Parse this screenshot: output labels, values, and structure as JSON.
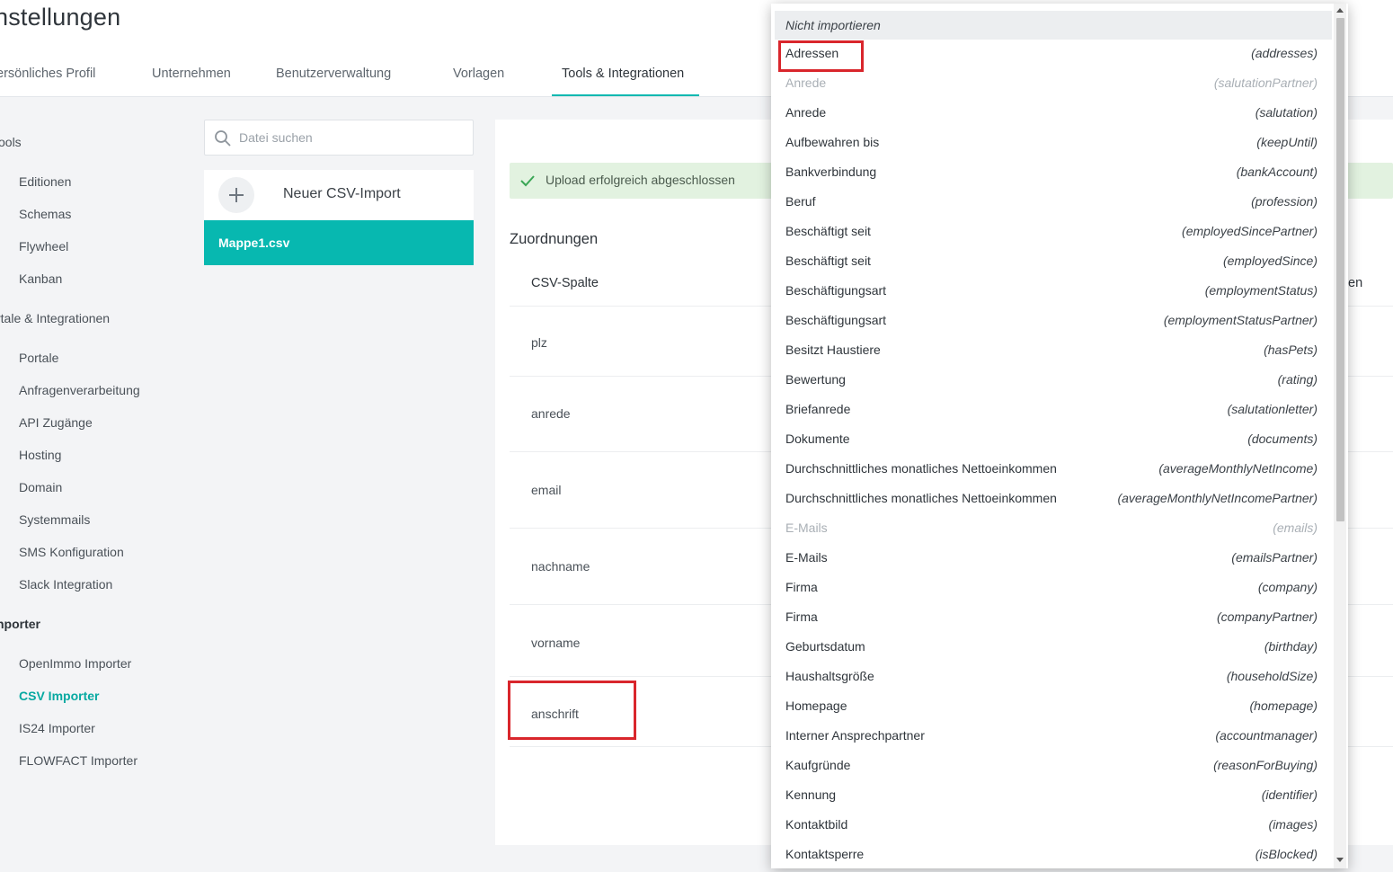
{
  "header": {
    "title": "nstellungen",
    "tabs": [
      {
        "label": "ersönliches Profil"
      },
      {
        "label": "Unternehmen"
      },
      {
        "label": "Benutzerverwaltung"
      },
      {
        "label": "Vorlagen"
      },
      {
        "label": "Tools & Integrationen"
      }
    ]
  },
  "sidebar": {
    "groups": [
      {
        "heading": "ools",
        "items": [
          "Editionen",
          "Schemas",
          "Flywheel",
          "Kanban"
        ]
      },
      {
        "heading": "rtale & Integrationen",
        "items": [
          "Portale",
          "Anfragenverarbeitung",
          "API Zugänge",
          "Hosting",
          "Domain",
          "Systemmails",
          "SMS Konfiguration",
          "Slack Integration"
        ]
      },
      {
        "heading": "nporter",
        "items": [
          "OpenImmo Importer",
          "CSV Importer",
          "IS24 Importer",
          "FLOWFACT Importer"
        ]
      }
    ]
  },
  "files": {
    "search_placeholder": "Datei suchen",
    "new_import_label": "Neuer CSV-Import",
    "selected_file": "Mappe1.csv"
  },
  "main": {
    "alert": "Upload erfolgreich abgeschlossen",
    "section_title": "Zuordnungen",
    "column_header": "CSV-Spalte",
    "column_header_peek": "en",
    "rows": [
      "plz",
      "anrede",
      "email",
      "nachname",
      "vorname",
      "anschrift"
    ]
  },
  "dropdown": {
    "header": "Nicht importieren",
    "items": [
      {
        "label": "Adressen",
        "key": "(addresses)",
        "disabled": false
      },
      {
        "label": "Anrede",
        "key": "(salutationPartner)",
        "disabled": true
      },
      {
        "label": "Anrede",
        "key": "(salutation)",
        "disabled": false
      },
      {
        "label": "Aufbewahren bis",
        "key": "(keepUntil)",
        "disabled": false
      },
      {
        "label": "Bankverbindung",
        "key": "(bankAccount)",
        "disabled": false
      },
      {
        "label": "Beruf",
        "key": "(profession)",
        "disabled": false
      },
      {
        "label": "Beschäftigt seit",
        "key": "(employedSincePartner)",
        "disabled": false
      },
      {
        "label": "Beschäftigt seit",
        "key": "(employedSince)",
        "disabled": false
      },
      {
        "label": "Beschäftigungsart",
        "key": "(employmentStatus)",
        "disabled": false
      },
      {
        "label": "Beschäftigungsart",
        "key": "(employmentStatusPartner)",
        "disabled": false
      },
      {
        "label": "Besitzt Haustiere",
        "key": "(hasPets)",
        "disabled": false
      },
      {
        "label": "Bewertung",
        "key": "(rating)",
        "disabled": false
      },
      {
        "label": "Briefanrede",
        "key": "(salutationletter)",
        "disabled": false
      },
      {
        "label": "Dokumente",
        "key": "(documents)",
        "disabled": false
      },
      {
        "label": "Durchschnittliches monatliches Nettoeinkommen",
        "key": "(averageMonthlyNetIncome)",
        "disabled": false
      },
      {
        "label": "Durchschnittliches monatliches Nettoeinkommen",
        "key": "(averageMonthlyNetIncomePartner)",
        "disabled": false
      },
      {
        "label": "E-Mails",
        "key": "(emails)",
        "disabled": true
      },
      {
        "label": "E-Mails",
        "key": "(emailsPartner)",
        "disabled": false
      },
      {
        "label": "Firma",
        "key": "(company)",
        "disabled": false
      },
      {
        "label": "Firma",
        "key": "(companyPartner)",
        "disabled": false
      },
      {
        "label": "Geburtsdatum",
        "key": "(birthday)",
        "disabled": false
      },
      {
        "label": "Haushaltsgröße",
        "key": "(householdSize)",
        "disabled": false
      },
      {
        "label": "Homepage",
        "key": "(homepage)",
        "disabled": false
      },
      {
        "label": "Interner Ansprechpartner",
        "key": "(accountmanager)",
        "disabled": false
      },
      {
        "label": "Kaufgründe",
        "key": "(reasonForBuying)",
        "disabled": false
      },
      {
        "label": "Kennung",
        "key": "(identifier)",
        "disabled": false
      },
      {
        "label": "Kontaktbild",
        "key": "(images)",
        "disabled": false
      },
      {
        "label": "Kontaktsperre",
        "key": "(isBlocked)",
        "disabled": false
      }
    ]
  },
  "colors": {
    "accent": "#07b8b0",
    "highlight": "#d9262c",
    "success_bg": "#e2f2e0",
    "success_icon": "#3aa655"
  }
}
